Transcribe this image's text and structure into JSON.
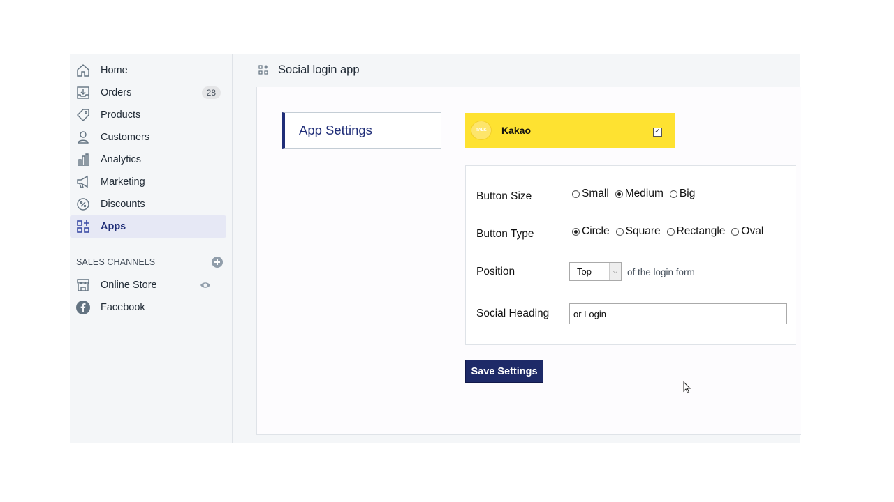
{
  "sidebar": {
    "items": [
      {
        "label": "Home",
        "icon": "home-icon"
      },
      {
        "label": "Orders",
        "icon": "orders-icon",
        "badge": "28"
      },
      {
        "label": "Products",
        "icon": "tag-icon"
      },
      {
        "label": "Customers",
        "icon": "person-icon"
      },
      {
        "label": "Analytics",
        "icon": "bar-chart-icon"
      },
      {
        "label": "Marketing",
        "icon": "megaphone-icon"
      },
      {
        "label": "Discounts",
        "icon": "discount-icon"
      },
      {
        "label": "Apps",
        "icon": "apps-icon",
        "active": true
      }
    ],
    "sales_channels": {
      "heading": "SALES CHANNELS",
      "items": [
        {
          "label": "Online Store",
          "icon": "store-icon"
        },
        {
          "label": "Facebook",
          "icon": "facebook-icon"
        }
      ]
    }
  },
  "topbar": {
    "title": "Social login app"
  },
  "settings": {
    "tab_label": "App Settings",
    "provider": {
      "name": "Kakao",
      "logo_text": "TALK",
      "enabled": true,
      "color": "#fee231"
    },
    "button_size": {
      "label": "Button Size",
      "options": [
        "Small",
        "Medium",
        "Big"
      ],
      "selected": "Medium"
    },
    "button_type": {
      "label": "Button Type",
      "options": [
        "Circle",
        "Square",
        "Rectangle",
        "Oval"
      ],
      "selected": "Circle"
    },
    "position": {
      "label": "Position",
      "value": "Top",
      "suffix": "of the login form"
    },
    "social_heading": {
      "label": "Social Heading",
      "value": "or Login"
    },
    "save_label": "Save Settings"
  },
  "colors": {
    "accent": "#202e78",
    "sidebar_bg": "#f4f6f8"
  }
}
